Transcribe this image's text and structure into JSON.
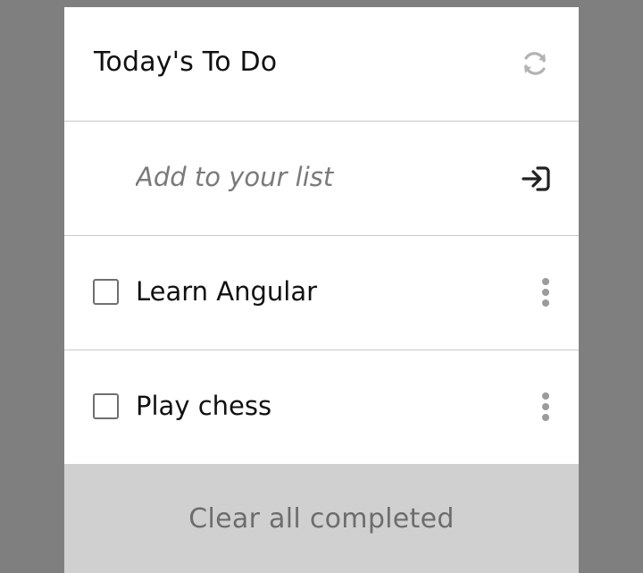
{
  "header": {
    "title": "Today's To Do",
    "refresh_icon": "refresh-icon"
  },
  "add": {
    "placeholder": "Add to your list",
    "submit_icon": "sign-in-arrow-icon"
  },
  "items": [
    {
      "label": "Learn Angular",
      "checked": false,
      "menu_icon": "kebab-menu-icon"
    },
    {
      "label": "Play chess",
      "checked": false,
      "menu_icon": "kebab-menu-icon"
    }
  ],
  "footer": {
    "clear_label": "Clear all completed"
  },
  "colors": {
    "backdrop": "#7f7f7f",
    "card": "#ffffff",
    "footer_bg": "#d1d0d1",
    "muted_icon": "#b3b3b3",
    "divider": "#c9c9c9"
  }
}
